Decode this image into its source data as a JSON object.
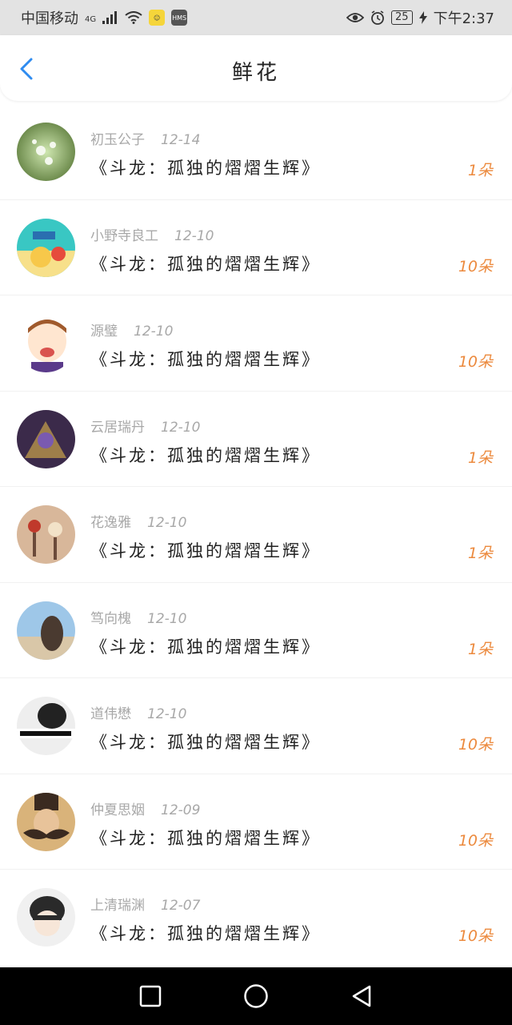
{
  "status_bar": {
    "carrier": "中国移动",
    "network": "4G",
    "battery": "25",
    "time": "下午2:37",
    "app_icon_1": "notes-app-icon",
    "app_icon_2": "HMS"
  },
  "header": {
    "title": "鲜花",
    "back_icon": "chevron-left-icon"
  },
  "items": [
    {
      "name": "初玉公子",
      "date": "12-14",
      "book": "《斗龙：孤独的熠熠生辉》",
      "count": "1朵",
      "avatar_colors": [
        "#cfe7b0",
        "#5b7a3a"
      ]
    },
    {
      "name": "小野寺良工",
      "date": "12-10",
      "book": "《斗龙：孤独的熠熠生辉》",
      "count": "10朵",
      "avatar_colors": [
        "#39c7c3",
        "#f7c84a"
      ]
    },
    {
      "name": "源璧",
      "date": "12-10",
      "book": "《斗龙：孤独的熠熠生辉》",
      "count": "10朵",
      "avatar_colors": [
        "#ffe6d0",
        "#a05a2c"
      ]
    },
    {
      "name": "云居瑞丹",
      "date": "12-10",
      "book": "《斗龙：孤独的熠熠生辉》",
      "count": "1朵",
      "avatar_colors": [
        "#3b2a4a",
        "#c9a24a"
      ]
    },
    {
      "name": "花逸雅",
      "date": "12-10",
      "book": "《斗龙：孤独的熠熠生辉》",
      "count": "1朵",
      "avatar_colors": [
        "#d8b79a",
        "#6b4a3a"
      ]
    },
    {
      "name": "笃向槐",
      "date": "12-10",
      "book": "《斗龙：孤独的熠熠生辉》",
      "count": "1朵",
      "avatar_colors": [
        "#9ec7e8",
        "#4a3a30"
      ]
    },
    {
      "name": "道伟懋",
      "date": "12-10",
      "book": "《斗龙：孤独的熠熠生辉》",
      "count": "10朵",
      "avatar_colors": [
        "#eeeeee",
        "#222222"
      ]
    },
    {
      "name": "仲夏思姻",
      "date": "12-09",
      "book": "《斗龙：孤独的熠熠生辉》",
      "count": "10朵",
      "avatar_colors": [
        "#d9b37a",
        "#3a2a20"
      ]
    },
    {
      "name": "上清瑞渊",
      "date": "12-07",
      "book": "《斗龙：孤独的熠熠生辉》",
      "count": "10朵",
      "avatar_colors": [
        "#f0f0f0",
        "#2a2a2a"
      ]
    }
  ],
  "nav_bar": {
    "recent": "square-icon",
    "home": "circle-icon",
    "back": "triangle-back-icon"
  },
  "colors": {
    "accent_blue": "#2f8cf0",
    "count_orange": "#ec8a3e",
    "meta_gray": "#a8a8a8"
  }
}
